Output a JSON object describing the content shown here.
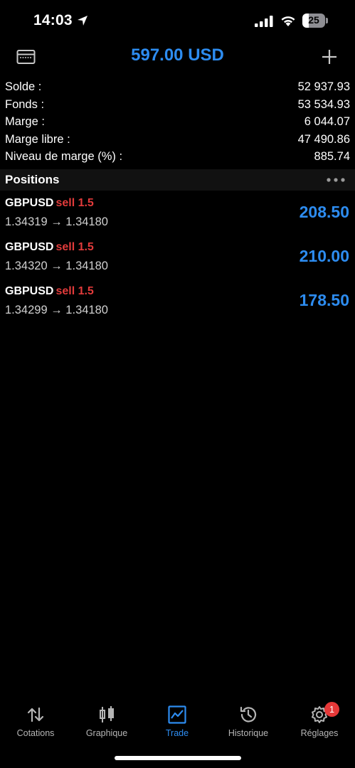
{
  "status_bar": {
    "time": "14:03",
    "battery": "25"
  },
  "header": {
    "title": "597.00 USD"
  },
  "summary": [
    {
      "label": "Solde :",
      "value": "52 937.93"
    },
    {
      "label": "Fonds :",
      "value": "53 534.93"
    },
    {
      "label": "Marge :",
      "value": "6 044.07"
    },
    {
      "label": "Marge libre :",
      "value": "47 490.86"
    },
    {
      "label": "Niveau de marge (%) :",
      "value": "885.74"
    }
  ],
  "positions_section": {
    "title": "Positions"
  },
  "positions": [
    {
      "symbol": "GBPUSD",
      "side": "sell 1.5",
      "prices": "1.34319 → 1.34180",
      "profit": "208.50"
    },
    {
      "symbol": "GBPUSD",
      "side": "sell 1.5",
      "prices": "1.34320 → 1.34180",
      "profit": "210.00"
    },
    {
      "symbol": "GBPUSD",
      "side": "sell 1.5",
      "prices": "1.34299 → 1.34180",
      "profit": "178.50"
    }
  ],
  "tabs": [
    {
      "label": "Cotations",
      "icon": "arrows-up-down-icon",
      "active": false
    },
    {
      "label": "Graphique",
      "icon": "candlestick-icon",
      "active": false
    },
    {
      "label": "Trade",
      "icon": "trade-chart-icon",
      "active": true
    },
    {
      "label": "Historique",
      "icon": "history-icon",
      "active": false
    },
    {
      "label": "Réglages",
      "icon": "gear-icon",
      "active": false,
      "badge": "1"
    }
  ],
  "colors": {
    "accent": "#2d8cf0",
    "sell": "#e23b3b",
    "badge": "#e63838",
    "background": "#000000"
  }
}
